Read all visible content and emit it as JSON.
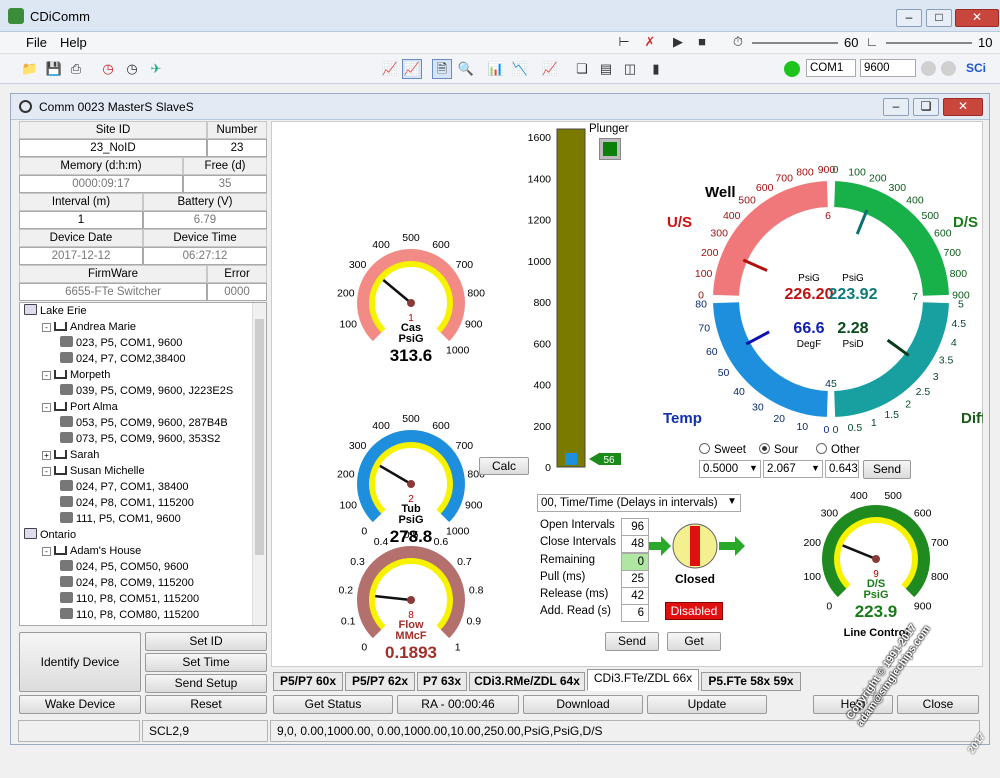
{
  "window": {
    "title": "CDiComm",
    "child_title": "Comm 0023 MasterS SlaveS"
  },
  "menu": {
    "file": "File",
    "help": "Help"
  },
  "toolbar": {
    "slider1_value": "60",
    "slider2_value": "10",
    "port": "COM1",
    "baud": "9600",
    "brand": "SCi"
  },
  "info": {
    "site_id_label": "Site ID",
    "number_label": "Number",
    "site_id": "23_NoID",
    "number": "23",
    "memory_label": "Memory (d:h:m)",
    "free_label": "Free (d)",
    "memory": "0000:09:17",
    "free": "35",
    "interval_label": "Interval (m)",
    "battery_label": "Battery (V)",
    "interval": "1",
    "battery": "6.79",
    "date_label": "Device Date",
    "time_label": "Device Time",
    "date": "2017-12-12",
    "time": "06:27:12",
    "firmware_label": "FirmWare",
    "error_label": "Error",
    "firmware": "6655-FTe Switcher",
    "error": "0000"
  },
  "tree": [
    {
      "text": "Lake Erie",
      "level": 0,
      "icon": "pc",
      "exp": ""
    },
    {
      "text": "Andrea Marie",
      "level": 1,
      "icon": "net",
      "exp": "-"
    },
    {
      "text": "023, P5, COM1, 9600",
      "level": 2,
      "icon": "dev",
      "exp": ""
    },
    {
      "text": "024, P7, COM2,38400",
      "level": 2,
      "icon": "dev",
      "exp": ""
    },
    {
      "text": "Morpeth",
      "level": 1,
      "icon": "net",
      "exp": "-"
    },
    {
      "text": "039, P5, COM9, 9600, J223E2S",
      "level": 2,
      "icon": "dev",
      "exp": ""
    },
    {
      "text": "Port Alma",
      "level": 1,
      "icon": "net",
      "exp": "-"
    },
    {
      "text": "053, P5, COM9, 9600, 287B4B",
      "level": 2,
      "icon": "dev",
      "exp": ""
    },
    {
      "text": "073, P5, COM9, 9600, 353S2",
      "level": 2,
      "icon": "dev",
      "exp": ""
    },
    {
      "text": "Sarah",
      "level": 1,
      "icon": "net",
      "exp": "+"
    },
    {
      "text": "Susan Michelle",
      "level": 1,
      "icon": "net",
      "exp": "-"
    },
    {
      "text": "024, P7, COM1, 38400",
      "level": 2,
      "icon": "dev",
      "exp": ""
    },
    {
      "text": "024, P8, COM1, 115200",
      "level": 2,
      "icon": "dev",
      "exp": ""
    },
    {
      "text": "111, P5, COM1, 9600",
      "level": 2,
      "icon": "dev",
      "exp": ""
    },
    {
      "text": "Ontario",
      "level": 0,
      "icon": "pc",
      "exp": ""
    },
    {
      "text": "Adam's House",
      "level": 1,
      "icon": "net",
      "exp": "-"
    },
    {
      "text": "024, P5, COM50, 9600",
      "level": 2,
      "icon": "dev",
      "exp": ""
    },
    {
      "text": "024, P8, COM9, 115200",
      "level": 2,
      "icon": "dev",
      "exp": ""
    },
    {
      "text": "110, P8, COM51, 115200",
      "level": 2,
      "icon": "dev",
      "exp": ""
    },
    {
      "text": "110, P8, COM80, 115200",
      "level": 2,
      "icon": "dev",
      "exp": ""
    }
  ],
  "buttons": {
    "identify": "Identify Device",
    "set_id": "Set ID",
    "set_time": "Set Time",
    "send_setup": "Send Setup",
    "wake": "Wake Device",
    "reset": "Reset",
    "get_status": "Get Status",
    "ra": "RA - 00:00:46",
    "download": "Download",
    "update": "Update",
    "help": "Help",
    "close": "Close",
    "calc": "Calc",
    "send": "Send",
    "get": "Get",
    "send2": "Send"
  },
  "gauges": {
    "cas": {
      "ticks": [
        "100",
        "200",
        "300",
        "400",
        "500",
        "600",
        "700",
        "800",
        "900",
        "1000"
      ],
      "num": "1",
      "name": "Cas",
      "unit": "PsiG",
      "value": "313.6",
      "reading": 313.6,
      "min": 0,
      "max": 1000,
      "colors": [
        "#f28a86",
        "#f6f200"
      ]
    },
    "tub": {
      "ticks": [
        "0",
        "100",
        "200",
        "300",
        "400",
        "500",
        "600",
        "700",
        "800",
        "900",
        "1000"
      ],
      "num": "2",
      "name": "Tub",
      "unit": "PsiG",
      "value": "278.8",
      "reading": 278.8,
      "min": 0,
      "max": 1000,
      "colors": [
        "#1e8fdc",
        "#f6f200"
      ]
    },
    "flow": {
      "ticks": [
        "0",
        "0.1",
        "0.2",
        "0.3",
        "0.4",
        "0.5",
        "0.6",
        "0.7",
        "0.8",
        "0.9",
        "1"
      ],
      "num": "8",
      "name": "Flow",
      "unit": "MMcF",
      "value": "0.1893",
      "reading": 0.1893,
      "min": 0,
      "max": 1,
      "colors": [
        "#b4706c",
        "#f6f200"
      ]
    },
    "line": {
      "ticks": [
        "0",
        "100",
        "200",
        "300",
        "400",
        "500",
        "600",
        "700",
        "800",
        "900"
      ],
      "num": "9",
      "name": "D/S",
      "unit": "PsiG",
      "value": "223.9",
      "reading": 223.9,
      "min": 0,
      "max": 900,
      "colors": [
        "#1f8a1f",
        "#f6f200"
      ],
      "caption": "Line Control"
    }
  },
  "plunger": {
    "label": "Plunger",
    "ticks": [
      "0",
      "200",
      "400",
      "600",
      "800",
      "1000",
      "1200",
      "1400",
      "1600"
    ],
    "marker": "56"
  },
  "well": {
    "title": "Well",
    "us": "U/S",
    "ds": "D/S",
    "temp": "Temp",
    "diff": "Diff",
    "us_ticks": [
      "0",
      "100",
      "200",
      "300",
      "400",
      "500",
      "600",
      "700",
      "800",
      "900"
    ],
    "ds_ticks": [
      "0",
      "100",
      "200",
      "300",
      "400",
      "500",
      "600",
      "700",
      "800",
      "900"
    ],
    "temp_ticks": [
      "0",
      "10",
      "20",
      "30",
      "40",
      "50",
      "60",
      "70",
      "80"
    ],
    "diff_ticks": [
      "0",
      "0.5",
      "1",
      "1.5",
      "2",
      "2.5",
      "3",
      "3.5",
      "4",
      "4.5",
      "5"
    ],
    "marks": {
      "us": "6",
      "ds": "7",
      "temp": "4",
      "diff": "5"
    },
    "us_unit": "PsiG",
    "us_value": "226.20",
    "ds_unit": "PsiG",
    "ds_value": "223.92",
    "temp_value": "66.6",
    "temp_unit": "DegF",
    "diff_value": "2.28",
    "diff_unit": "PsiD",
    "gas_sweet": "Sweet",
    "gas_sour": "Sour",
    "gas_other": "Other",
    "gas_selected": "Sour",
    "sg": "0.5000",
    "co2": "2.067",
    "val3": "0.643"
  },
  "timing": {
    "mode": "00, Time/Time (Delays in intervals)",
    "open_label": "Open Intervals",
    "open": "96",
    "closed_label": "Close Intervals",
    "closed": "48",
    "remain_label": "Remaining",
    "remain": "0",
    "pull_label": "Pull (ms)",
    "pull": "25",
    "release_label": "Release (ms)",
    "release": "42",
    "addread_label": "Add. Read (s)",
    "addread": "6",
    "valve_state": "Closed",
    "disabled": "Disabled"
  },
  "tabs": [
    "P5/P7 60x",
    "P5/P7 62x",
    "P7 63x",
    "CDi3.RMe/ZDL 64x",
    "CDi3.FTe/ZDL 66x",
    "P5.FTe 58x 59x"
  ],
  "status": {
    "s1": "SCL2,9",
    "s2": "9,0, 0.00,1000.00, 0.00,1000.00,10.00,250.00,PsiG,PsiG,D/S"
  },
  "watermark": {
    "line1": "Copyright © 1991-2017",
    "line2": "adam@singlechips.com",
    "year": "2017"
  }
}
